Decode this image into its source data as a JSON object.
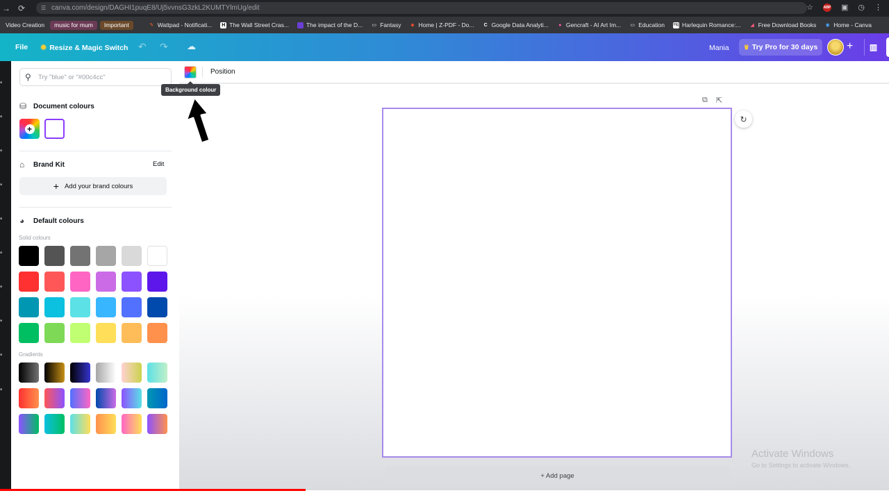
{
  "browser": {
    "url": "canva.com/design/DAGHI1puqE8/Uj5vvnsG3zkL2KUMTYlmUg/edit",
    "bookmarks": [
      {
        "label": "Video Creation",
        "kind": "plain"
      },
      {
        "label": "music for mum",
        "kind": "tag-pink"
      },
      {
        "label": "Important",
        "kind": "tag-brown"
      },
      {
        "label": "Wattpad - Notificati...",
        "icon": "wattpad-icon"
      },
      {
        "label": "The Wall Street Cras...",
        "icon": "h-icon"
      },
      {
        "label": "The impact of the D...",
        "icon": "purple-icon"
      },
      {
        "label": "Fantasy",
        "icon": "folder-icon"
      },
      {
        "label": "Home | Z-PDF - Do...",
        "icon": "zpdf-icon"
      },
      {
        "label": "Google Data Analyti...",
        "icon": "coursera-icon"
      },
      {
        "label": "Gencraft - AI Art Im...",
        "icon": "gencraft-icon"
      },
      {
        "label": "Education",
        "icon": "folder-icon"
      },
      {
        "label": "Harlequin Romance:...",
        "icon": "harlequin-icon"
      },
      {
        "label": "Free Download Books",
        "icon": "book-icon"
      },
      {
        "label": "Home - Canva",
        "icon": "canva-icon"
      }
    ]
  },
  "header": {
    "file": "File",
    "resize": "Resize & Magic Switch",
    "user": "Mania",
    "try_pro": "Try Pro for 30 days"
  },
  "panel": {
    "search_placeholder": "Try \"blue\" or \"#00c4cc\"",
    "document_colours": "Document colours",
    "brand_kit": "Brand Kit",
    "edit": "Edit",
    "add_brand": "Add your brand colours",
    "default_colours": "Default colours",
    "solid_colours": "Solid colours",
    "gradients": "Gradients",
    "solid_swatches": [
      "#000000",
      "#545454",
      "#737373",
      "#a6a6a6",
      "#d9d9d9",
      "#ffffff",
      "#ff3131",
      "#ff5757",
      "#ff66c4",
      "#cb6ce6",
      "#8c52ff",
      "#5e17eb",
      "#0097b2",
      "#0cc0df",
      "#5ce1e6",
      "#38b6ff",
      "#5271ff",
      "#004aad",
      "#00bf63",
      "#7ed957",
      "#c1ff72",
      "#ffde59",
      "#ffbd59",
      "#ff914d"
    ],
    "gradient_swatches": [
      [
        "#000000",
        "#737373"
      ],
      [
        "#000000",
        "#c89116"
      ],
      [
        "#000000",
        "#3533cd"
      ],
      [
        "#a6a6a6",
        "#ffffff"
      ],
      [
        "#ffd1d1",
        "#cbd34d"
      ],
      [
        "#5de0e6",
        "#c0f0c8"
      ],
      [
        "#ff3131",
        "#ff914d"
      ],
      [
        "#ff5757",
        "#8c52ff"
      ],
      [
        "#5170ff",
        "#ff66c4"
      ],
      [
        "#004aad",
        "#cb6ce6"
      ],
      [
        "#8c52ff",
        "#5ce1e6"
      ],
      [
        "#0097b2",
        "#0066cc"
      ],
      [
        "#8c52ff",
        "#00bf63"
      ],
      [
        "#0cc0df",
        "#00bf63"
      ],
      [
        "#5de0e6",
        "#ffde59"
      ],
      [
        "#ff914d",
        "#ffde59"
      ],
      [
        "#ff66c4",
        "#ffde59"
      ],
      [
        "#8c52ff",
        "#ff914d"
      ]
    ]
  },
  "toolbar": {
    "position": "Position",
    "tooltip": "Background colour"
  },
  "canvas": {
    "add_page": "+ Add page"
  },
  "watermark": {
    "line1": "Activate Windows",
    "line2": "Go to Settings to activate Windows."
  },
  "video": {
    "progress_fraction": 0.344
  }
}
